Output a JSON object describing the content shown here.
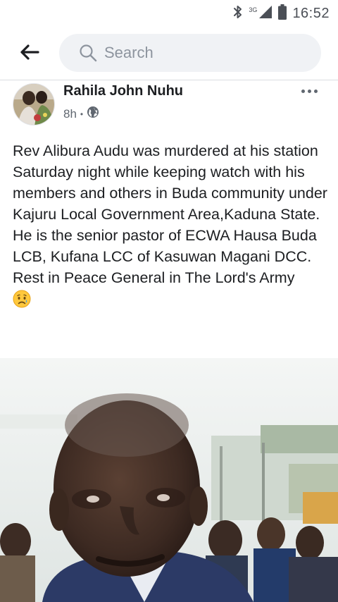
{
  "status_bar": {
    "network": "3G",
    "time": "16:52",
    "icons": [
      "bluetooth-icon",
      "signal-icon",
      "battery-icon"
    ]
  },
  "header": {
    "back_icon": "arrow-left-icon",
    "search_icon": "search-icon",
    "search_placeholder": "Search"
  },
  "post": {
    "author": "Rahila John Nuhu",
    "time": "8h",
    "separator": "•",
    "privacy_icon": "globe-icon",
    "more_icon": "more-horizontal-icon",
    "text_lines": [
      "Rev Alibura Audu was murdered at his station Saturday night while keeping watch with his members and others in Buda community under Kajuru Local Government Area,Kaduna State.",
      "He is the senior pastor of ECWA Hausa Buda LCB, Kufana LCC of Kasuwan Magani DCC.",
      "Rest in Peace General in The Lord's Army"
    ],
    "emoji": "sad-tear-emoji"
  },
  "colors": {
    "text": "#1c1e21",
    "meta": "#606770",
    "search_bg": "#f0f2f5",
    "placeholder": "#8d949e",
    "divider": "#dadde1"
  }
}
